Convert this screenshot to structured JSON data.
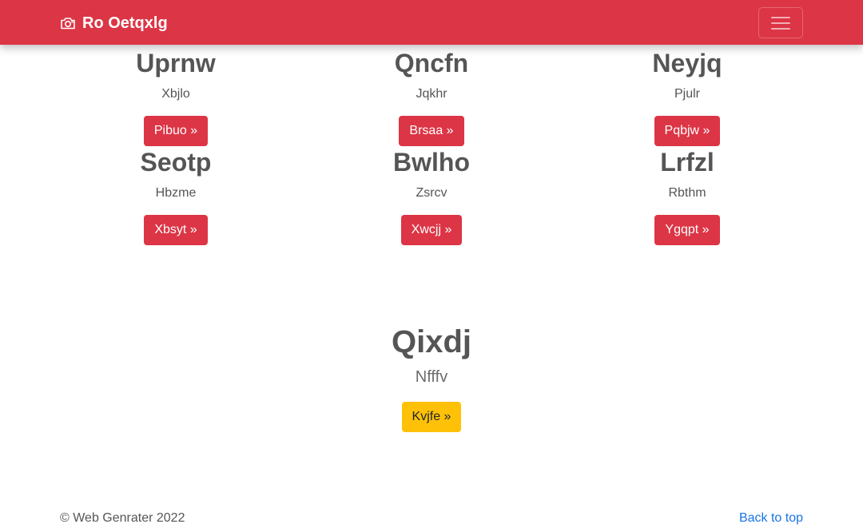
{
  "navbar": {
    "brand": "Ro Oetqxlg",
    "brand_icon": "camera-icon",
    "toggler_icon": "hamburger-icon"
  },
  "cards": [
    {
      "title": "Uprnw",
      "subtitle": "Xbjlo",
      "button": "Pibuo »"
    },
    {
      "title": "Qncfn",
      "subtitle": "Jqkhr",
      "button": "Brsaa »"
    },
    {
      "title": "Neyjq",
      "subtitle": "Pjulr",
      "button": "Pqbjw »"
    },
    {
      "title": "Seotp",
      "subtitle": "Hbzme",
      "button": "Xbsyt »"
    },
    {
      "title": "Bwlho",
      "subtitle": "Zsrcv",
      "button": "Xwcjj »"
    },
    {
      "title": "Lrfzl",
      "subtitle": "Rbthm",
      "button": "Ygqpt »"
    }
  ],
  "feature": {
    "title": "Qixdj",
    "subtitle": "Nfffv",
    "button": "Kvjfe »"
  },
  "footer": {
    "copyright": "© Web Genrater 2022",
    "back_to_top": "Back to top"
  },
  "colors": {
    "primary": "#dc3545",
    "warning": "#ffc107",
    "link": "#1a73e8"
  }
}
